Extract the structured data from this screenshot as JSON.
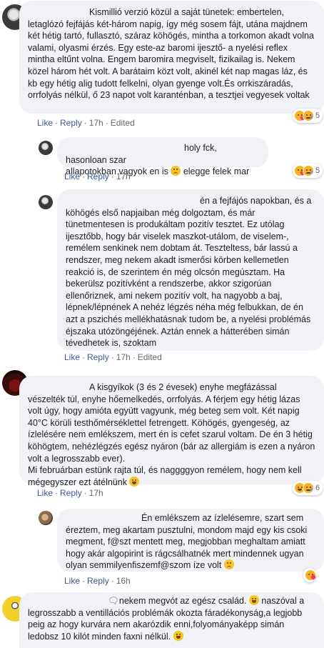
{
  "comments": [
    {
      "text": "Kismillió verzió közül a saját tünetek: embertelen, letaglózó fejfájás két-három napig, így még sosem fájt, utána majdnem két hétig tartó, fullasztó, száraz köhögés, mintha a torkomon akadt volna valami, olyasmi érzés. Egy este-az baromi ijesztő- a nyelési reflex mintha eltűnt volna. Engem baromira megviselt, fizikailag is. Nekem közel három hét volt. A barátaim közt volt, akinél két nap magas láz, és kb egy hétig alig tudott felkelni, olyan gyenge volt.És orrkiszáradás, orrfolyás nélkül, ő 23 napot volt karanténban, a tesztjei vegyesek voltak",
      "like": "Like",
      "reply": "Reply",
      "time": "17h",
      "edited": "Edited",
      "reaction_count": "5"
    },
    {
      "text_a": "holy fck, hasonloan szar",
      "text_b": "allapotokban vagyok en is",
      "text_c": "elegge felek mar",
      "like": "Like",
      "reply": "Reply",
      "time": "17h",
      "reaction_count": "5"
    },
    {
      "text": "én a fejfájós napokban, és a köhögés első napjaiban még dolgoztam, és már tünetmentesen is produkáltam pozitív tesztet. Ez utólag ijesztőbb, hogy bár viselek maszkot-utálom, de viselem-, remélem senkinek nem dobtam át. Teszteltess, bár lassú a rendszer, meg nekem akadt ismerősi körben kellemetlen reakció is, de szerintem én még olcsón megúsztam. Ha bekerülsz pozitívként a rendszerbe, akkor szigorúan ellenőriznek, ami nekem pozitív volt, ha nagyobb a baj, lépnek/lépnének A nehéz légzés néha még felbukkan, de én azt a pszichés mellékhatásnak tudom be, a nyelési problémás éjszaka utózöngéjének. Aztán ennek a hátterében simán tévedhetek is, szoktam",
      "like": "Like",
      "reply": "Reply",
      "time": "17h",
      "edited": "Edited"
    },
    {
      "text": "A kisgyíkok (3 és 2 évesek) enyhe megfázással vészelték túl, enyhe hőemelkedés, orrfolyás. A férjem egy hétig lázas volt úgy, hogy amióta együtt vagyunk, még beteg sem volt. Két napig 40°C körüli testhőmérséklettel fetrengett. Köhögés, gyengeség, az ízlelésére nem emlékszem, mert én is cefet szarul voltam. De én 3 hétig köhögtem, nehézlégzés egész nyáron (bár az allergiám is ezen a nyáron volt a legrosszabb ever).",
      "text2": "Mi februárban estünk rajta túl, és naggggyon remélem, hogy nem kell mégegyszer ezt átélnünk",
      "like": "Like",
      "reply": "Reply",
      "time": "17h",
      "reaction_count": "6"
    },
    {
      "text": "Én emlékszem az ízlelésemre, szart sem éreztem, meg akartam pusztulni, mondom majd egy kis csoki megment, f@szt mentett meg, megjobban meghaltam amiatt hogy akár algopirint is rágcsálhatnék mert mindennek ugyan olyan semmilyenfiszemf@szom íze volt",
      "like": "Like",
      "reply": "Reply",
      "time": "16h"
    },
    {
      "text_a": "nekem megvót az egész család.",
      "text_b": "naszóval a legrosszabb a ventillációs problémák okozta fáradékonyság,a legjobb peig az hogy kurvára nem akarózdik enni,folyományaképp simán ledobsz 10 kilót minden faxni nélkül."
    }
  ],
  "colors": {
    "bubble": "#f0f2f5",
    "link": "#385898",
    "meta": "#65676b",
    "text": "#1c1e21"
  }
}
